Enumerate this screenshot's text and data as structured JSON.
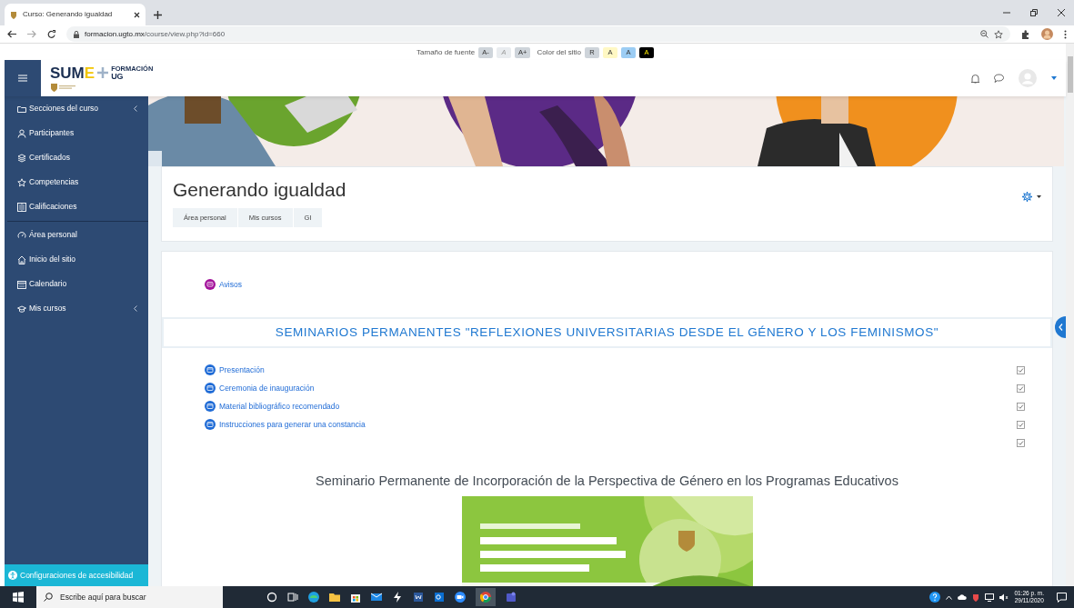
{
  "browser": {
    "tab_title": "Curso: Generando igualdad",
    "url_host": "formacion.ugto.mx",
    "url_path": "/course/view.php?id=660"
  },
  "a11y_bar": {
    "font_label": "Tamaño de fuente",
    "font_buttons": [
      {
        "label": "A-",
        "disabled": false
      },
      {
        "label": "A",
        "disabled": true
      },
      {
        "label": "A+",
        "disabled": false
      }
    ],
    "color_label": "Color del sitio",
    "color_buttons": [
      {
        "label": "R",
        "color": "#ced4da"
      },
      {
        "label": "A",
        "color": "#fff8c4"
      },
      {
        "label": "A",
        "color": "#9ccdf4"
      },
      {
        "label": "A",
        "color": "#000000"
      }
    ]
  },
  "logo": {
    "main": "SUM",
    "accent": "E",
    "super": "FORMACIÓN",
    "sub": "UG"
  },
  "sidebar": {
    "groups": [
      [
        {
          "label": "Secciones del curso",
          "has_submenu": true
        },
        {
          "label": "Participantes",
          "has_submenu": false
        },
        {
          "label": "Certificados",
          "has_submenu": false
        },
        {
          "label": "Competencias",
          "has_submenu": false
        },
        {
          "label": "Calificaciones",
          "has_submenu": false
        }
      ],
      [
        {
          "label": "Área personal",
          "has_submenu": false
        },
        {
          "label": "Inicio del sitio",
          "has_submenu": false
        },
        {
          "label": "Calendario",
          "has_submenu": false
        },
        {
          "label": "Mis cursos",
          "has_submenu": true
        }
      ]
    ],
    "footer": "Configuraciones de accesibilidad"
  },
  "course": {
    "title": "Generando igualdad",
    "breadcrumb": [
      "Área personal",
      "Mis cursos",
      "GI"
    ]
  },
  "sections": [
    {
      "activities": [
        {
          "kind": "forum",
          "label": "Avisos"
        }
      ]
    },
    {
      "title": "SEMINARIOS PERMANENTES \"REFLEXIONES UNIVERSITARIAS DESDE EL GÉNERO Y LOS FEMINISMOS\"",
      "activities": [
        {
          "kind": "page",
          "label": "Presentación",
          "checked": true
        },
        {
          "kind": "page",
          "label": "Ceremonia de inauguración",
          "checked": true
        },
        {
          "kind": "page",
          "label": "Material bibliográfico recomendado",
          "checked": true
        },
        {
          "kind": "page",
          "label": "Instrucciones para generar una constancia",
          "checked": true
        },
        {
          "kind": "label",
          "heading": "Seminario Permanente de Incorporación de la Perspectiva de Género en los Programas Educativos",
          "checked": true
        }
      ]
    }
  ],
  "taskbar": {
    "search_placeholder": "Escribe aquí para buscar",
    "time": "01:26 p. m.",
    "date": "29/11/2020"
  }
}
